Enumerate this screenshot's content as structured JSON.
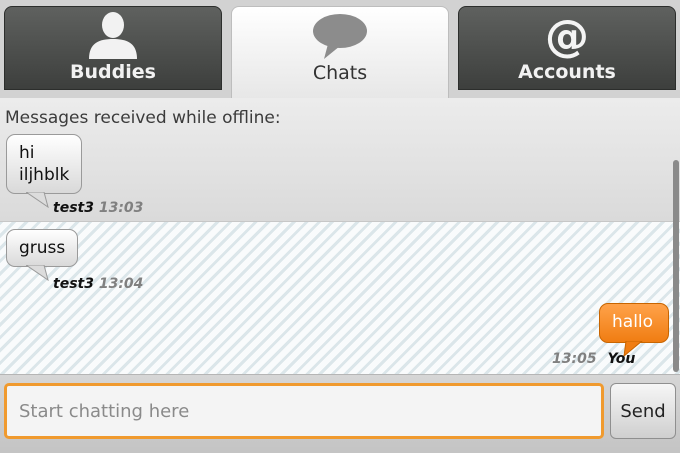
{
  "tabs": {
    "buddies": {
      "label": "Buddies",
      "icon": "person-icon"
    },
    "chats": {
      "label": "Chats",
      "icon": "speech-bubble-icon"
    },
    "accounts": {
      "label": "Accounts",
      "icon": "at-sign-icon",
      "glyph": "@"
    }
  },
  "conversation": {
    "offline_header": "Messages received while offline:",
    "messages": [
      {
        "lines": [
          "hi",
          "iljhblk"
        ],
        "sender": "test3",
        "time": "13:03",
        "direction": "incoming"
      },
      {
        "lines": [
          "gruss"
        ],
        "sender": "test3",
        "time": "13:04",
        "direction": "incoming"
      },
      {
        "lines": [
          "hallo"
        ],
        "sender": "You",
        "time": "13:05",
        "direction": "outgoing"
      }
    ]
  },
  "input": {
    "placeholder": "Start chatting here",
    "value": ""
  },
  "send_button": {
    "label": "Send"
  },
  "colors": {
    "accent_orange": "#f08a1f",
    "incoming_bubble": "#e6e6e6",
    "tab_dark": "#4a4c4a"
  }
}
